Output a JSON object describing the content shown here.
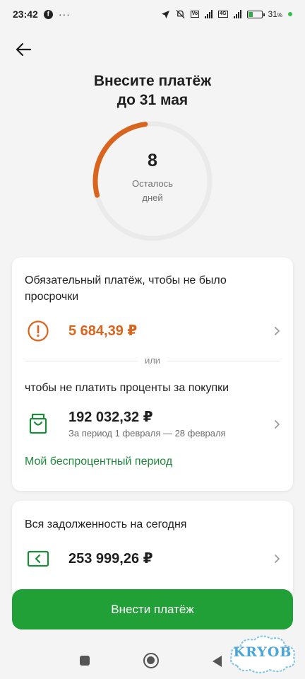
{
  "status": {
    "time": "23:42",
    "fb": "f",
    "dots": "···",
    "net": "4G",
    "battery": "31",
    "battery_unit": "%"
  },
  "colors": {
    "accent_green": "#21a038",
    "link_green": "#1e8a3c",
    "warning_orange": "#d9641e"
  },
  "header": {
    "title_line1": "Внесите платёж",
    "title_line2": "до 31 мая"
  },
  "gauge": {
    "value": "8",
    "label_line1": "Осталось",
    "label_line2": "дней",
    "progress_fraction": 0.23
  },
  "card_mandatory": {
    "heading_line1": "Обязательный платёж, чтобы не было",
    "heading_line2": "просрочки",
    "amount": "5 684,39 ₽",
    "icon": "exclamation-circle-icon",
    "divider_label": "или",
    "grace_heading": "чтобы не платить проценты за покупки",
    "grace_amount": "192 032,32 ₽",
    "grace_period": "За период 1 февраля — 28 февраля",
    "grace_icon": "shopping-bag-icon",
    "link_label": "Мой беспроцентный период"
  },
  "card_total": {
    "heading": "Вся задолженность на сегодня",
    "amount": "253 999,26 ₽",
    "icon": "card-arrow-icon"
  },
  "actions": {
    "pay_label": "Внести платёж"
  },
  "watermark": {
    "text": "KRYOB"
  }
}
